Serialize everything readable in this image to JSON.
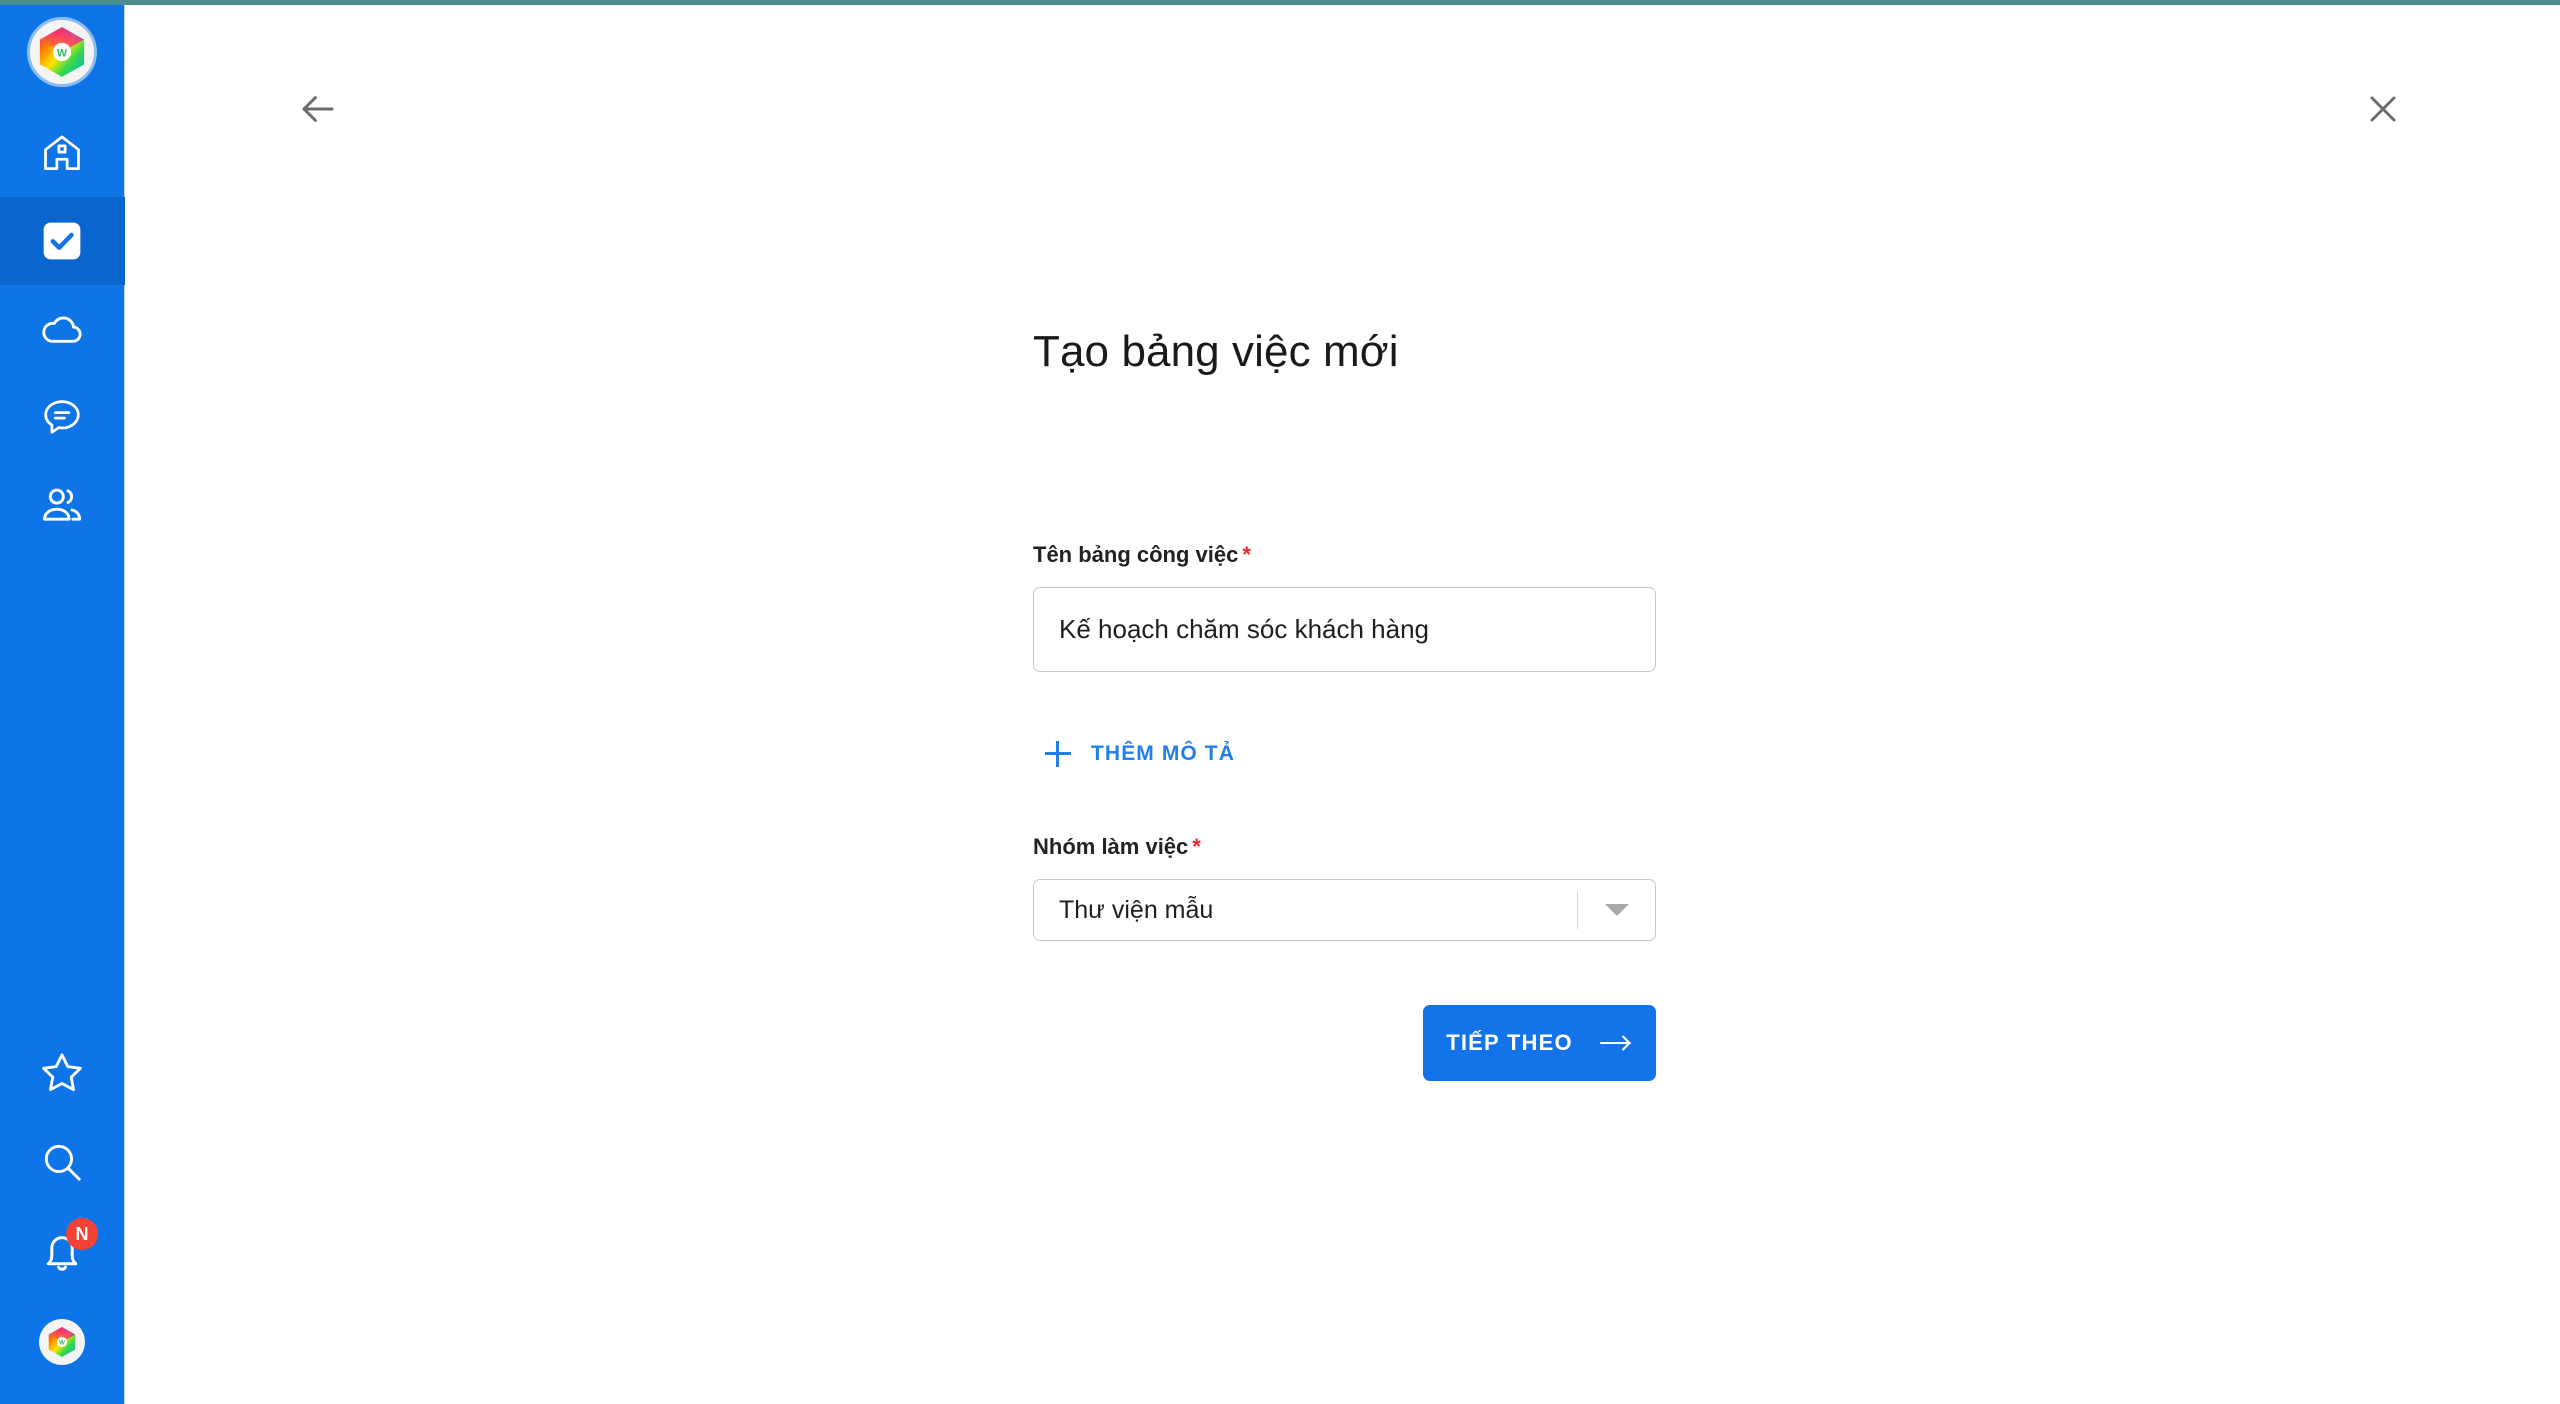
{
  "app": {
    "brand_logo": "rainbow-hexagon-logo",
    "accent_color": "#1274e8",
    "sidebar_color": "#0d75e8",
    "sidebar_active_color": "#0a66cf",
    "required_star_color": "#f5222d",
    "top_accent_color": "#4a8e8e"
  },
  "sidebar": {
    "logo_label": "W",
    "items": [
      {
        "icon": "home-icon",
        "name": "sidebar-item-home",
        "active": false
      },
      {
        "icon": "checkbox-task-icon",
        "name": "sidebar-item-tasks",
        "active": true
      },
      {
        "icon": "cloud-icon",
        "name": "sidebar-item-cloud",
        "active": false
      },
      {
        "icon": "chat-bubble-icon",
        "name": "sidebar-item-chat",
        "active": false
      },
      {
        "icon": "users-icon",
        "name": "sidebar-item-people",
        "active": false
      }
    ],
    "bottom_items": [
      {
        "icon": "star-icon",
        "name": "sidebar-item-favorites"
      },
      {
        "icon": "search-icon",
        "name": "sidebar-item-search"
      },
      {
        "icon": "bell-icon",
        "name": "sidebar-item-notifications",
        "badge": "N"
      },
      {
        "icon": "avatar-icon",
        "name": "sidebar-item-account"
      }
    ]
  },
  "topbar": {
    "back_icon": "arrow-left-icon",
    "close_icon": "close-icon"
  },
  "main": {
    "title": "Tạo bảng việc mới",
    "board_name": {
      "label": "Tên bảng công việc",
      "required_mark": "*",
      "value": "Kế hoạch chăm sóc khách hàng",
      "placeholder": "Tên bảng công việc"
    },
    "add_description": {
      "label": "THÊM MÔ TẢ",
      "icon": "plus-icon"
    },
    "workspace": {
      "label": "Nhóm làm việc",
      "required_mark": "*",
      "selected": "Thư viện mẫu",
      "arrow_icon": "chevron-down-icon"
    },
    "next_button": {
      "label": "TIẾP THEO",
      "icon": "arrow-right-icon"
    }
  }
}
